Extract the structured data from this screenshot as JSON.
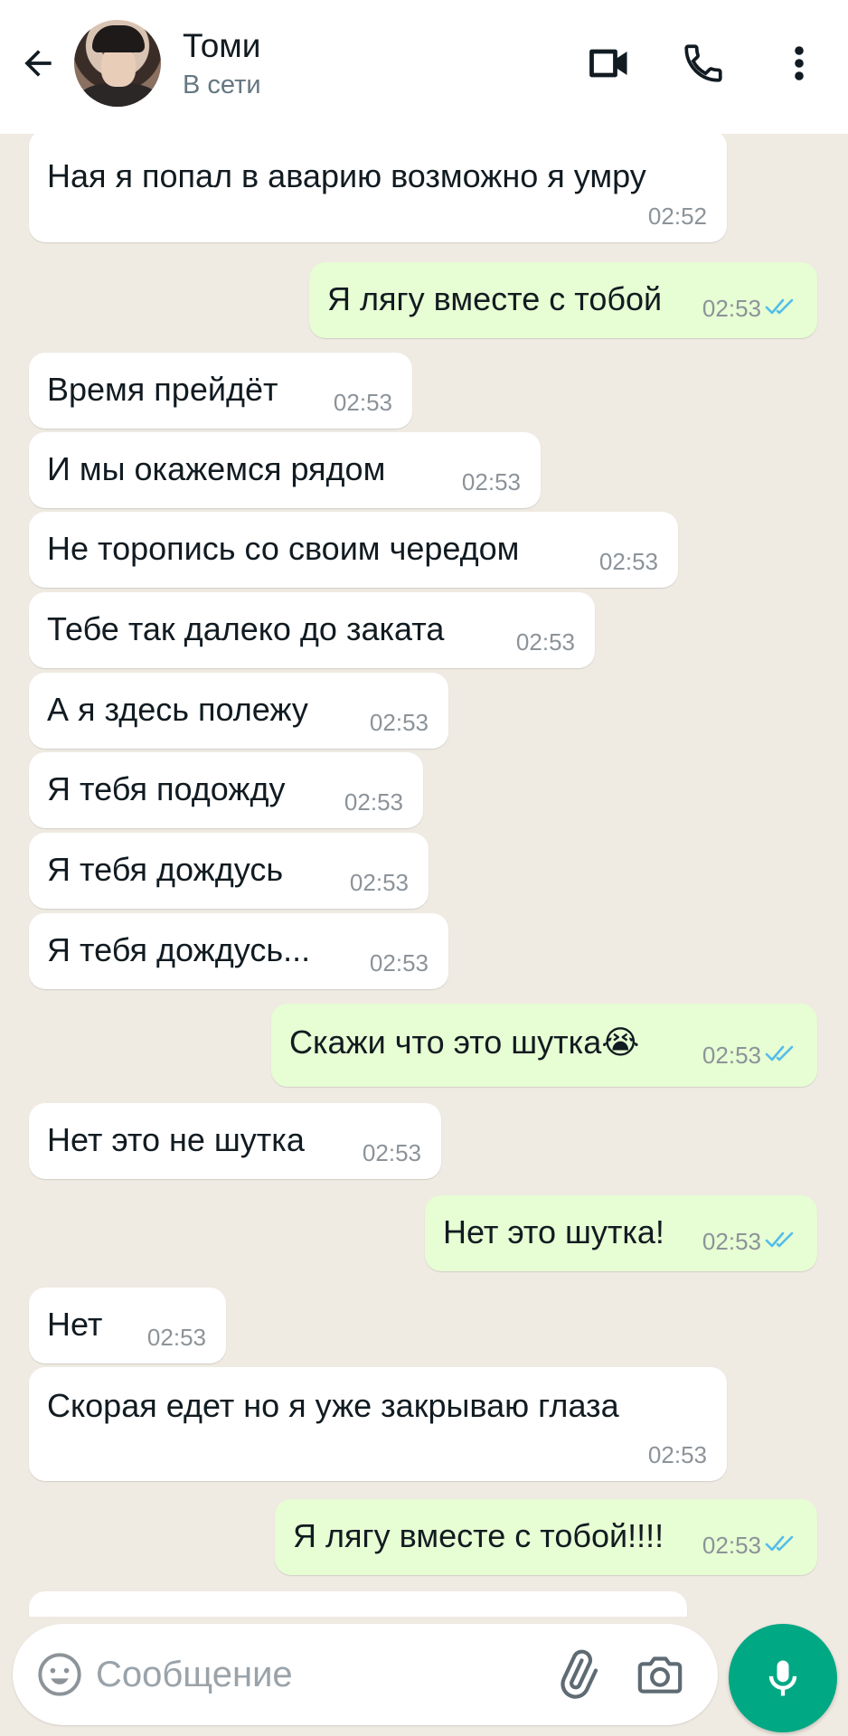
{
  "header": {
    "contact_name": "Томи",
    "status": "В сети",
    "icons": [
      "back-arrow-icon",
      "video-call-icon",
      "phone-icon",
      "more-vert-icon"
    ]
  },
  "messages": [
    {
      "dir": "in",
      "text": "Ная я попал в аварию возможно я умру",
      "time": "02:52"
    },
    {
      "dir": "out",
      "text": "Я лягу вместе с тобой",
      "time": "02:53",
      "read": true
    },
    {
      "dir": "in",
      "text": "Время прейдёт",
      "time": "02:53"
    },
    {
      "dir": "in",
      "text": "И мы окажемся рядом",
      "time": "02:53"
    },
    {
      "dir": "in",
      "text": "Не торопись со своим чередом",
      "time": "02:53"
    },
    {
      "dir": "in",
      "text": "Тебе так далеко до заката",
      "time": "02:53"
    },
    {
      "dir": "in",
      "text": "А я здесь полежу",
      "time": "02:53"
    },
    {
      "dir": "in",
      "text": "Я тебя подожду",
      "time": "02:53"
    },
    {
      "dir": "in",
      "text": "Я тебя дождусь",
      "time": "02:53"
    },
    {
      "dir": "in",
      "text": "Я тебя дождусь...",
      "time": "02:53"
    },
    {
      "dir": "out",
      "text": "Скажи что это шутка😭",
      "time": "02:53",
      "read": true
    },
    {
      "dir": "in",
      "text": "Нет это не шутка",
      "time": "02:53"
    },
    {
      "dir": "out",
      "text": "Нет это шутка!",
      "time": "02:53",
      "read": true
    },
    {
      "dir": "in",
      "text": "Нет",
      "time": "02:53"
    },
    {
      "dir": "in",
      "text": "Скорая едет но я уже закрываю глаза",
      "time": "02:53"
    },
    {
      "dir": "out",
      "text": "Я лягу вместе с тобой!!!!",
      "time": "02:53",
      "read": true
    }
  ],
  "composer": {
    "placeholder": "Сообщение",
    "icons": [
      "emoji-icon",
      "attach-icon",
      "camera-icon",
      "mic-icon"
    ]
  },
  "colors": {
    "chat_bg": "#efeae2",
    "incoming_bubble": "#ffffff",
    "outgoing_bubble": "#e7fdd3",
    "read_ticks": "#53bdeb",
    "accent": "#00a884"
  }
}
